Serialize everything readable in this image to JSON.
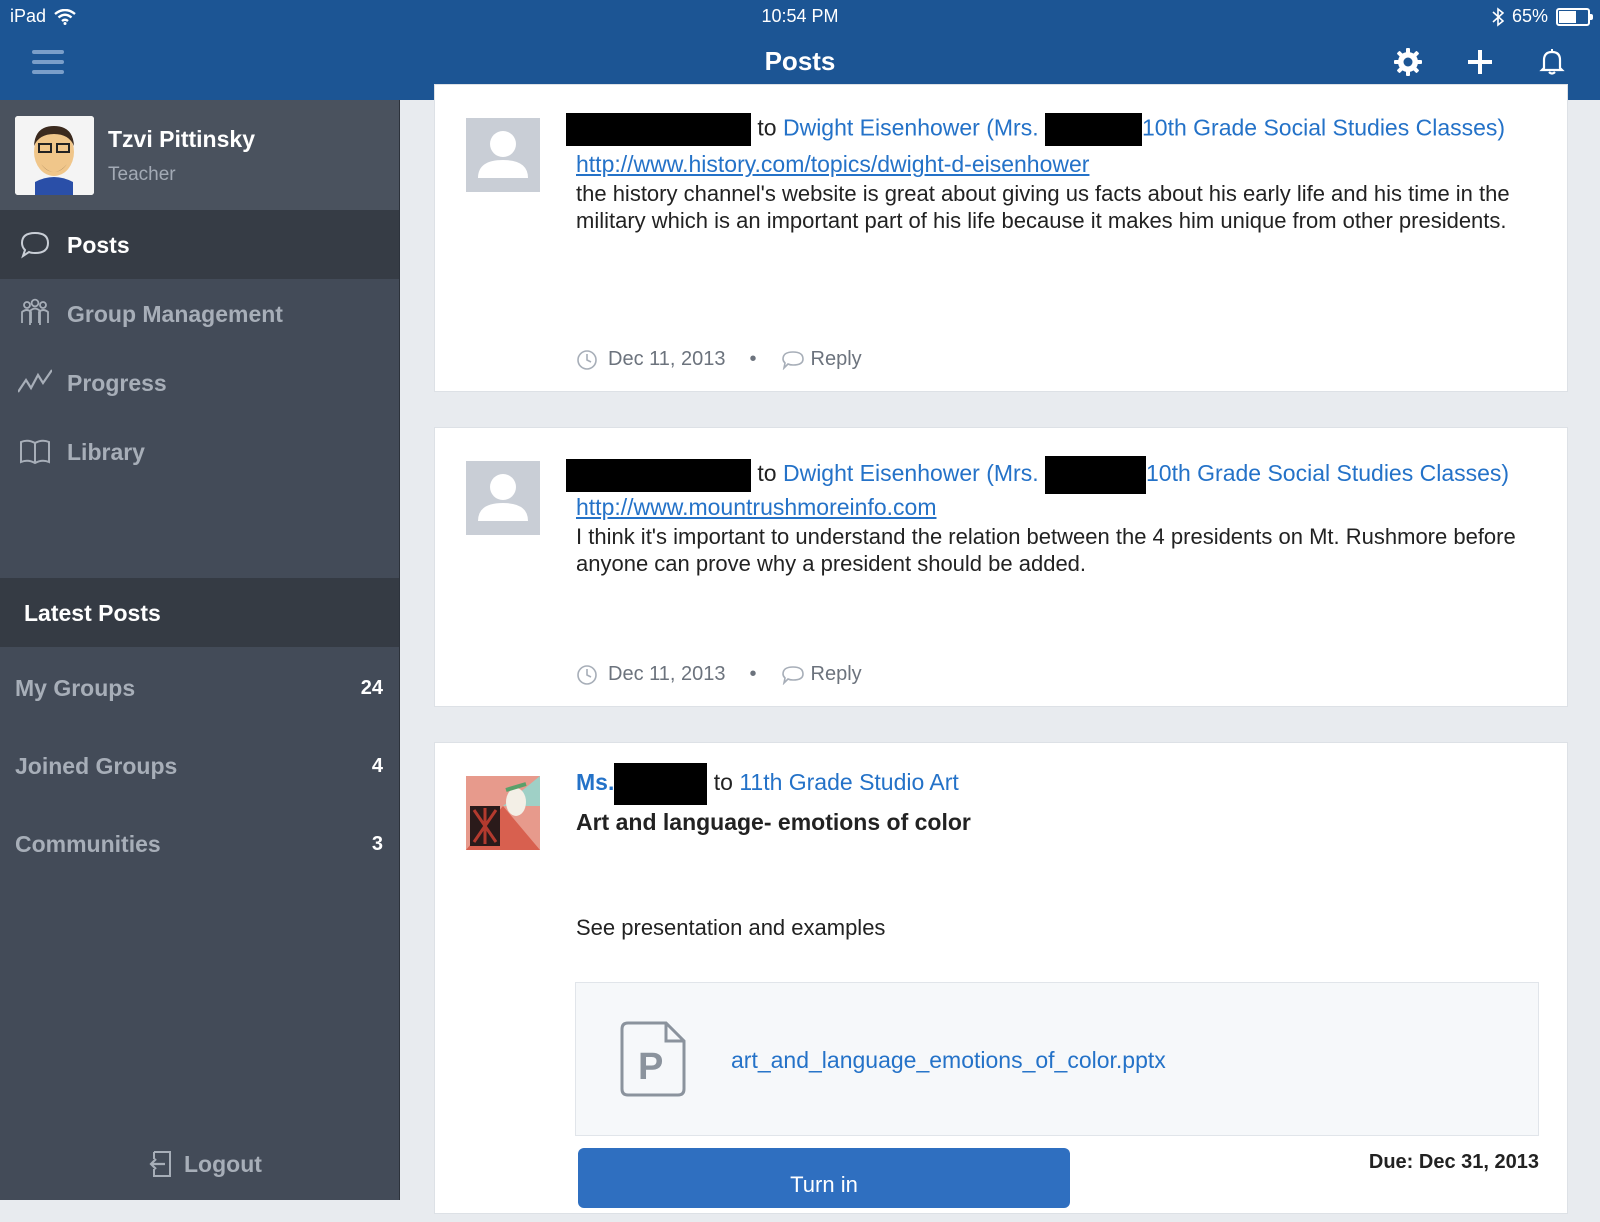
{
  "status_bar": {
    "device": "iPad",
    "time": "10:54 PM",
    "battery": "65%",
    "battery_level": 0.65
  },
  "nav": {
    "title": "Posts",
    "icons": [
      "menu-icon",
      "gear-icon",
      "plus-icon",
      "bell-icon"
    ]
  },
  "profile": {
    "name": "Tzvi Pittinsky",
    "role": "Teacher"
  },
  "menu": [
    {
      "label": "Posts",
      "icon": "speech-bubble-icon",
      "active": true
    },
    {
      "label": "Group Management",
      "icon": "group-icon"
    },
    {
      "label": "Progress",
      "icon": "chart-line-icon"
    },
    {
      "label": "Library",
      "icon": "book-icon"
    }
  ],
  "latest_posts": {
    "header": "Latest Posts",
    "groups": [
      {
        "label": "My Groups",
        "count": "24"
      },
      {
        "label": "Joined Groups",
        "count": "4"
      },
      {
        "label": "Communities",
        "count": "3"
      }
    ]
  },
  "logout": "Logout",
  "posts": [
    {
      "to": "to",
      "group_a": "Dwight Eisenhower (Mrs.",
      "group_b": "10th Grade Social Studies Classes)",
      "url": "http://www.history.com/topics/dwight-d-eisenhower",
      "body": "the history channel's website is great about giving us facts about his early life and his time in the military which is an important part of his life because it makes him unique from other presidents.",
      "date": "Dec 11, 2013",
      "reply": "Reply"
    },
    {
      "to": "to",
      "group_a": "Dwight Eisenhower (Mrs.",
      "group_b": "10th Grade Social Studies Classes)",
      "url": "http://www.mountrushmoreinfo.com",
      "body": "I think it's important to understand the relation between the 4 presidents on Mt. Rushmore before anyone can prove why a president should be added.",
      "date": "Dec 11, 2013",
      "reply": "Reply"
    },
    {
      "author_prefix": "Ms.",
      "to": "to",
      "group": "11th Grade Studio Art",
      "title": "Art and language- emotions of color",
      "body": "See presentation and examples",
      "attachment": "art_and_language_emotions_of_color.pptx",
      "turn_in": "Turn in",
      "due": "Due: Dec 31, 2013"
    }
  ],
  "colors": {
    "nav": "#1c5594",
    "sidebar": "#434b58",
    "link": "#2472c8",
    "button": "#2f6fc0"
  }
}
